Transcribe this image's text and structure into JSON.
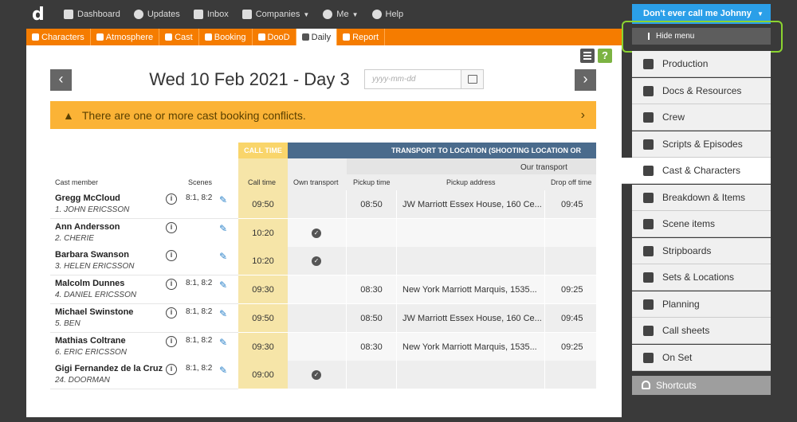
{
  "topnav": {
    "logo": "d",
    "items": [
      {
        "label": "Dashboard",
        "icon": "dashboard-icon"
      },
      {
        "label": "Updates",
        "icon": "updates-icon"
      },
      {
        "label": "Inbox",
        "icon": "inbox-icon"
      },
      {
        "label": "Companies",
        "icon": "companies-icon",
        "caret": true
      },
      {
        "label": "Me",
        "icon": "user-icon",
        "caret": true
      },
      {
        "label": "Help",
        "icon": "help-icon"
      }
    ]
  },
  "tabs": [
    {
      "label": "Characters"
    },
    {
      "label": "Atmosphere"
    },
    {
      "label": "Cast"
    },
    {
      "label": "Booking"
    },
    {
      "label": "DooD"
    },
    {
      "label": "Daily",
      "active": true
    },
    {
      "label": "Report"
    }
  ],
  "page": {
    "prev": "‹",
    "next": "›",
    "title": "Wed 10 Feb 2021 - Day 3",
    "date_placeholder": "yyyy-mm-dd",
    "help": "?"
  },
  "alert": {
    "text": "There are one or more cast booking conflicts.",
    "icon": "warning-icon"
  },
  "table": {
    "headers": {
      "cast_member": "Cast member",
      "scenes": "Scenes",
      "call_time_group": "CALL TIME",
      "transport_group": "TRANSPORT TO LOCATION (SHOOTING LOCATION OR",
      "our_transport": "Our transport",
      "call_time": "Call time",
      "own_transport": "Own transport",
      "pickup_time": "Pickup time",
      "pickup_address": "Pickup address",
      "drop_off_time": "Drop off time"
    },
    "rows": [
      {
        "name": "Gregg McCloud",
        "character": "1. JOHN ERICSSON",
        "scenes": "8:1, 8:2",
        "call": "09:50",
        "own": false,
        "pickup": "08:50",
        "address": "JW Marriott Essex House, 160 Ce...",
        "drop": "09:45"
      },
      {
        "name": "Ann Andersson",
        "character": "2. CHERIE",
        "scenes": "",
        "call": "10:20",
        "own": true,
        "pickup": "",
        "address": "",
        "drop": ""
      },
      {
        "name": "Barbara Swanson",
        "character": "3. HELEN ERICSSON",
        "scenes": "",
        "call": "10:20",
        "own": true,
        "pickup": "",
        "address": "",
        "drop": ""
      },
      {
        "name": "Malcolm Dunnes",
        "character": "4. DANIEL ERICSSON",
        "scenes": "8:1, 8:2",
        "call": "09:30",
        "own": false,
        "pickup": "08:30",
        "address": "New York Marriott Marquis, 1535...",
        "drop": "09:25"
      },
      {
        "name": "Michael Swinstone",
        "character": "5. BEN",
        "scenes": "8:1, 8:2",
        "call": "09:50",
        "own": false,
        "pickup": "08:50",
        "address": "JW Marriott Essex House, 160 Ce...",
        "drop": "09:45"
      },
      {
        "name": "Mathias Coltrane",
        "character": "6. ERIC ERICSSON",
        "scenes": "8:1, 8:2",
        "call": "09:30",
        "own": false,
        "pickup": "08:30",
        "address": "New York Marriott Marquis, 1535...",
        "drop": "09:25"
      },
      {
        "name": "Gigi Fernandez de la Cruz",
        "character": "24. DOORMAN",
        "scenes": "8:1, 8:2",
        "call": "09:00",
        "own": true,
        "pickup": "",
        "address": "",
        "drop": ""
      }
    ]
  },
  "sidebar": {
    "user_button": "Don't ever call me Johnny",
    "hide_menu": "Hide menu",
    "items": [
      {
        "label": "Production",
        "icon": "film-icon"
      },
      {
        "label": "Docs & Resources",
        "icon": "document-icon"
      },
      {
        "label": "Crew",
        "icon": "crew-icon"
      },
      {
        "label": "Scripts & Episodes",
        "icon": "script-icon"
      },
      {
        "label": "Cast & Characters",
        "icon": "masks-icon",
        "active": true
      },
      {
        "label": "Breakdown & Items",
        "icon": "breakdown-icon"
      },
      {
        "label": "Scene items",
        "icon": "scene-items-icon"
      },
      {
        "label": "Stripboards",
        "icon": "stripboard-icon"
      },
      {
        "label": "Sets & Locations",
        "icon": "locations-icon"
      },
      {
        "label": "Planning",
        "icon": "calendar-icon"
      },
      {
        "label": "Call sheets",
        "icon": "megaphone-icon"
      },
      {
        "label": "On Set",
        "icon": "hourglass-icon"
      }
    ],
    "shortcuts": "Shortcuts"
  },
  "colors": {
    "accent": "#f57c00",
    "call_time": "#f9d56b",
    "transport": "#4a6b8c",
    "alert": "#fbb336",
    "user_button": "#2b9fe8",
    "highlight": "#8bd430"
  }
}
